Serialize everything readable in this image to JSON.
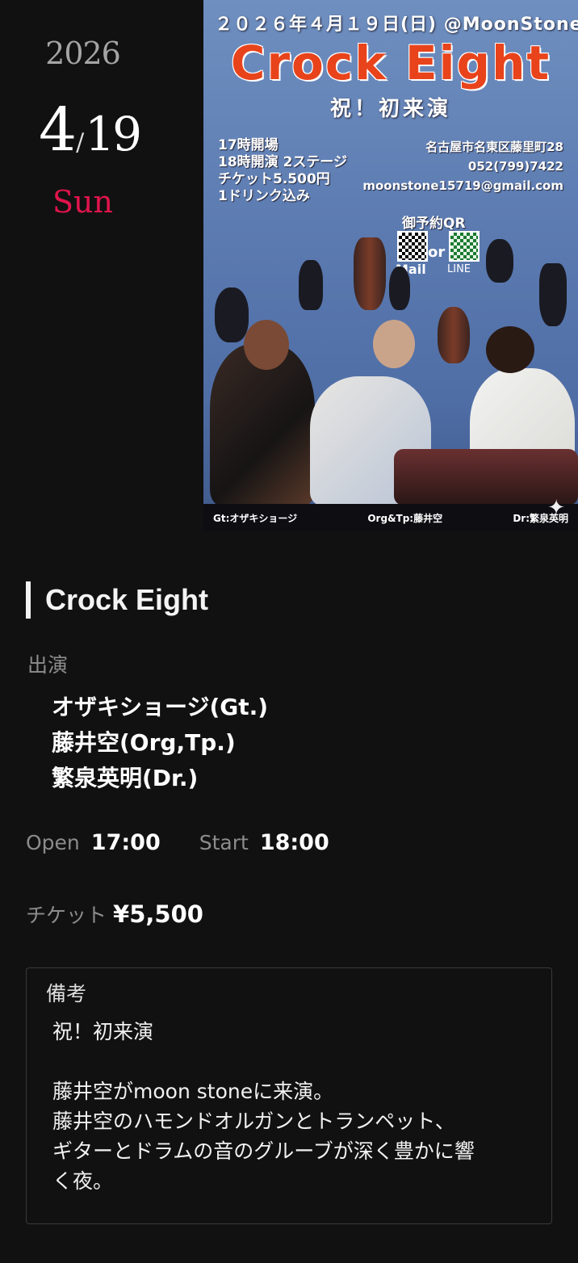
{
  "date": {
    "year": "2026",
    "month": "4",
    "slash": "/",
    "day": "19",
    "dow": "Sun"
  },
  "flyer": {
    "header": "２０２６年４月１９日(日) @MoonStone",
    "title": "Crock Eight",
    "subtitle": "祝！初来演",
    "info": [
      "17時開場",
      "18時開演 2ステージ",
      "チケット5.500円",
      "1ドリンク込み"
    ],
    "contact": [
      "名古屋市名東区藤里町28",
      "052(799)7422",
      "moonstone15719@gmail.com"
    ],
    "qr_title": "御予約QR",
    "qr_or": "or",
    "qr_mail": "Mail",
    "qr_line": "LINE",
    "credits": [
      "Gt:オザキショージ",
      "Org&Tp:藤井空",
      "Dr:繁泉英明"
    ]
  },
  "event": {
    "title": "Crock Eight",
    "performers_label": "出演",
    "performers": [
      "オザキショージ(Gt.)",
      "藤井空(Org,Tp.)",
      "繁泉英明(Dr.)"
    ],
    "open_label": "Open",
    "open_time": "17:00",
    "start_label": "Start",
    "start_time": "18:00",
    "ticket_label": "チケット",
    "ticket_price": "¥5,500",
    "notes_label": "備考",
    "notes_body": "祝！初来演\n\n藤井空がmoon stoneに来演。\n藤井空のハモンドオルガンとトランペット、\nギターとドラムの音のグルーブが深く豊かに響\nく夜。"
  },
  "colors": {
    "background": "#111111",
    "weekday": "#e0144c",
    "flyer_title": "#e8431b"
  }
}
